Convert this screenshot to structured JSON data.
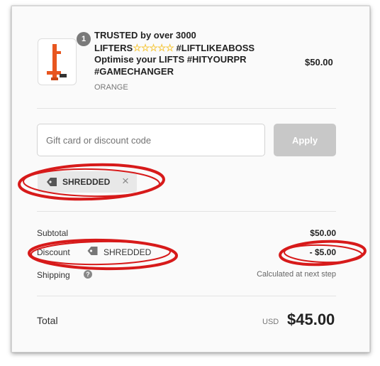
{
  "product": {
    "quantity": "1",
    "title_line1": "TRUSTED by over 3000",
    "title_line2_prefix": "LIFTERS",
    "stars": "☆☆☆☆☆",
    "title_line2_suffix": " #LIFTLIKEABOSS",
    "title_line3": "Optimise your LIFTS #HITYOURPR",
    "title_line4": "#GAMECHANGER",
    "variant": "ORANGE",
    "price": "$50.00",
    "image_icon": "orange-lifting-bar-icon"
  },
  "discount_form": {
    "placeholder": "Gift card or discount code",
    "value": "",
    "apply_label": "Apply"
  },
  "applied_code": {
    "code": "SHREDDED",
    "remove_icon": "close-icon",
    "tag_icon": "tag-icon"
  },
  "summary": {
    "subtotal_label": "Subtotal",
    "subtotal_value": "$50.00",
    "discount_label": "Discount",
    "discount_code": "SHREDDED",
    "discount_value": "- $5.00",
    "shipping_label": "Shipping",
    "shipping_value": "Calculated at next step",
    "help_icon": "?"
  },
  "total": {
    "label": "Total",
    "currency": "USD",
    "amount": "$45.00"
  },
  "colors": {
    "annotation_red": "#d71a1a",
    "product_orange": "#e8561f",
    "apply_disabled": "#c8c8c8"
  }
}
